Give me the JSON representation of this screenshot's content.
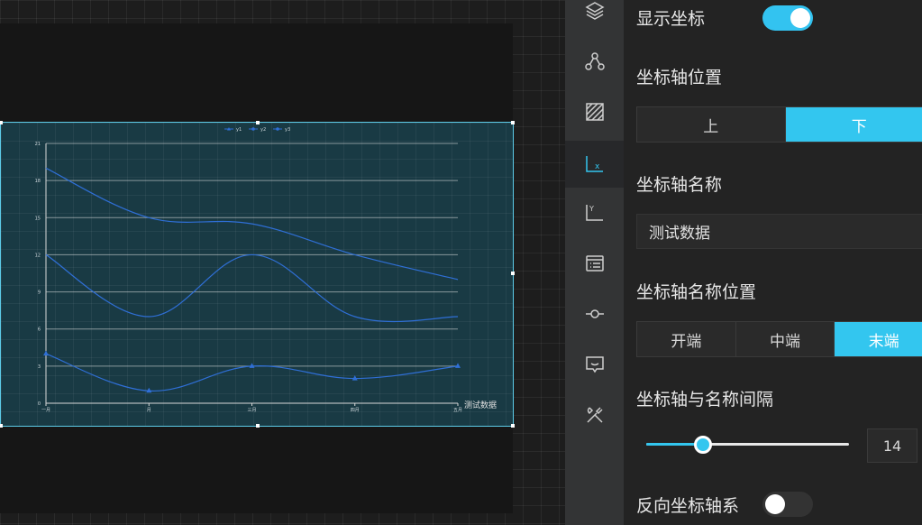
{
  "panel": {
    "show_axis_label": "显示坐标",
    "show_axis_on": true,
    "axis_position_label": "坐标轴位置",
    "axis_position_options": [
      "上",
      "下"
    ],
    "axis_position_selected": "下",
    "axis_name_label": "坐标轴名称",
    "axis_name_value": "测试数据",
    "axis_name_position_label": "坐标轴名称位置",
    "axis_name_position_options": [
      "开端",
      "中端",
      "末端"
    ],
    "axis_name_position_selected": "末端",
    "axis_name_gap_label": "坐标轴与名称间隔",
    "axis_name_gap_value": "14",
    "axis_name_gap_fraction": 0.28,
    "reverse_axis_label": "反向坐标轴系",
    "reverse_axis_on": false
  },
  "toolstrip": {
    "icons": [
      "layers-icon",
      "nodes-icon",
      "area-pattern-icon",
      "x-axis-icon",
      "y-axis-icon",
      "list-panel-icon",
      "line-point-icon",
      "tooltip-icon",
      "tools-icon"
    ],
    "active": "x-axis-icon",
    "x_axis_letter": "x",
    "y_axis_letter": "Y"
  },
  "chart_data": {
    "type": "line",
    "categories": [
      "一月",
      "月",
      "三月",
      "四月",
      "五月"
    ],
    "series": [
      {
        "name": "y1",
        "values": [
          19,
          15,
          14.5,
          12,
          10
        ],
        "marker": "none"
      },
      {
        "name": "y2",
        "values": [
          12,
          7,
          12,
          7,
          7
        ],
        "marker": "none"
      },
      {
        "name": "y3",
        "values": [
          4,
          1,
          3,
          2,
          3
        ],
        "marker": "triangle"
      }
    ],
    "legend": [
      "y1",
      "y2",
      "y3"
    ],
    "legend_position": "top-center",
    "ylim": [
      0,
      21
    ],
    "yticks": [
      "0",
      "3",
      "6",
      "9",
      "12",
      "15",
      "18",
      "21"
    ],
    "xlabel": "测试数据",
    "line_color": "#2f6fd6",
    "grid": true
  }
}
